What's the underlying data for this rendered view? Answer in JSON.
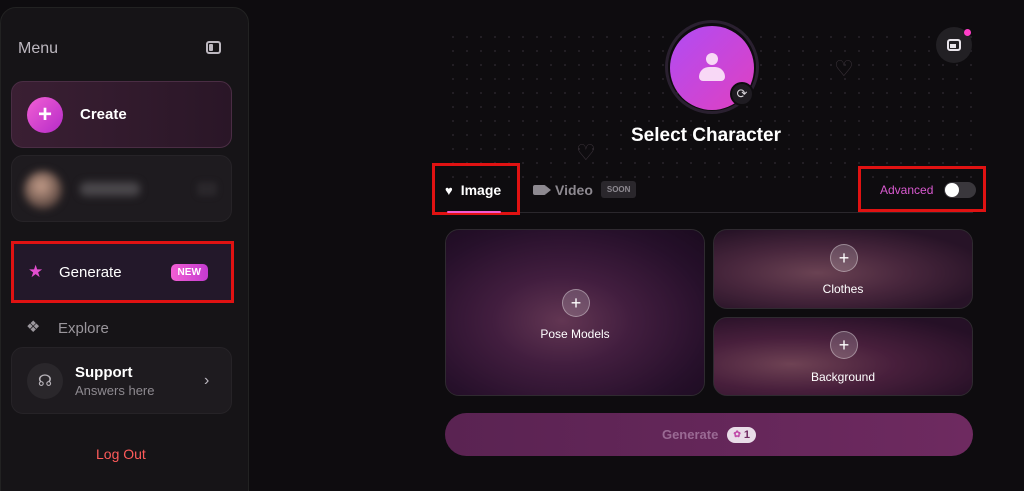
{
  "sidebar": {
    "menu_title": "Menu",
    "create_label": "Create",
    "create_plus": "+",
    "generate_label": "Generate",
    "generate_badge": "NEW",
    "explore_label": "Explore",
    "support_title": "Support",
    "support_subtitle": "Answers here",
    "logout_label": "Log Out"
  },
  "main": {
    "select_character_title": "Select Character",
    "tabs": [
      {
        "label": "Image",
        "active": true
      },
      {
        "label": "Video",
        "badge": "SOON"
      }
    ],
    "advanced_label": "Advanced",
    "advanced_enabled": false,
    "cards": {
      "pose": {
        "label": "Pose Models",
        "plus": "+"
      },
      "clothes": {
        "label": "Clothes",
        "plus": "+"
      },
      "background": {
        "label": "Background",
        "plus": "+"
      }
    },
    "generate_button": {
      "label": "Generate",
      "cost": "1"
    }
  },
  "colors": {
    "accent": "#f05ad0",
    "highlight_box": "#e01212",
    "logout": "#ff5a5a"
  },
  "icons": {
    "sidebar_collapse": "sidebar-toggle-icon",
    "generate": "star-wand-icon",
    "explore": "explore-icon",
    "support": "headset-icon",
    "swap": "refresh-icon",
    "gallery": "image-gallery-icon"
  }
}
